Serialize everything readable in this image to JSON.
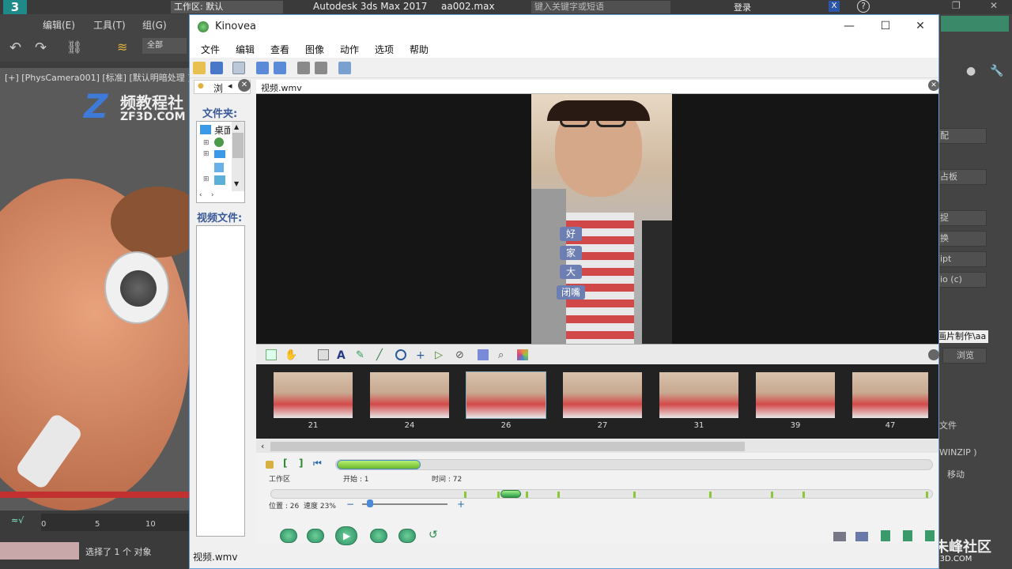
{
  "max": {
    "workspace": "工作区: 默认",
    "app_title": "Autodesk 3ds Max 2017",
    "file_name": "aa002.max",
    "search_placeholder": "键入关键字或短语",
    "login": "登录",
    "menu": [
      "编辑(E)",
      "工具(T)",
      "组(G)"
    ],
    "selection_filter": "全部",
    "viewport_label": "[+] [PhysCamera001] [标准] [默认明暗处理 ]",
    "watermark_line1": "频教程社",
    "watermark_line2": "ZF3D.COM",
    "right_panel_items": [
      "配",
      "占板",
      "捉",
      "换",
      "ipt",
      "io (c)",
      "画片制作\\aa",
      "浏览",
      "文件",
      "WINZIP )",
      "移动"
    ],
    "timeline_ticks": [
      "0",
      "5",
      "10"
    ],
    "status_text": "选择了 1 个 对象",
    "bottom_logo": "朱峰社区",
    "bottom_logo_sub": "ZF3D.COM"
  },
  "kinovea": {
    "title": "Kinovea",
    "menu": [
      "文件",
      "编辑",
      "查看",
      "图像",
      "动作",
      "选项",
      "帮助"
    ],
    "left_tab": "浏",
    "folders_label": "文件夹:",
    "folder_root": "桌面",
    "videos_label": "视频文件:",
    "video_tab_title": "视频.wmv",
    "video_tags": [
      "好",
      "家",
      "大",
      "闭嘴"
    ],
    "thumbnails": [
      {
        "label": "21"
      },
      {
        "label": "24"
      },
      {
        "label": "26"
      },
      {
        "label": "27"
      },
      {
        "label": "31"
      },
      {
        "label": "39"
      },
      {
        "label": "47"
      }
    ],
    "workzone_label": "工作区",
    "start_label": "开始 : 1",
    "time_label": "时间 : 72",
    "position_label": "位置 : 26",
    "speed_label": "速度 23%",
    "status_file": "视频.wmv",
    "colors": {
      "accent": "#6aa0d8",
      "play_green": "#2c8f62",
      "tag_blue": "#6d7fb2"
    }
  }
}
